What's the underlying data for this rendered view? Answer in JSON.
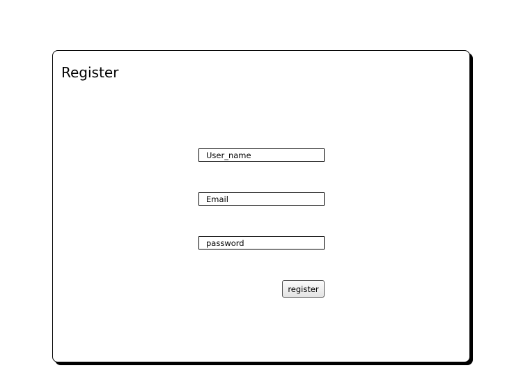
{
  "page": {
    "title": "Register"
  },
  "form": {
    "username_placeholder": "User_name",
    "email_placeholder": "Email",
    "password_placeholder": "password",
    "submit_label": "register"
  },
  "colors": {
    "border": "#000000",
    "background": "#ffffff",
    "shadow": "#000000"
  }
}
